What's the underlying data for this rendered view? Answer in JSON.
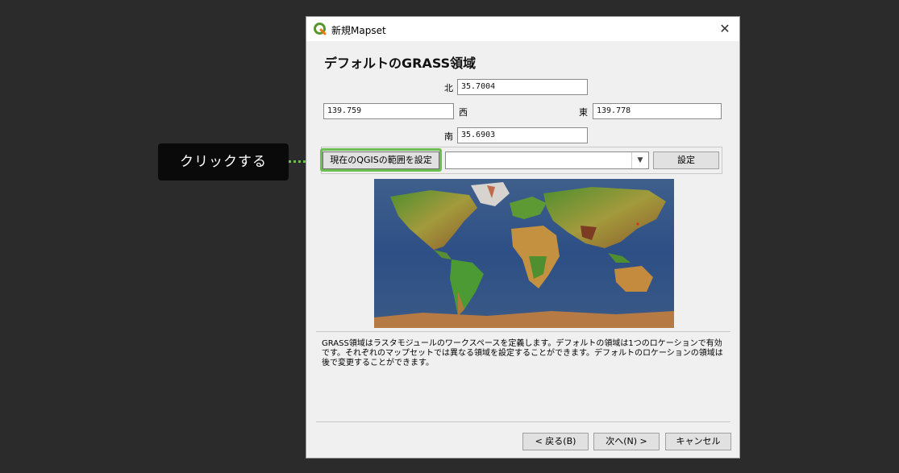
{
  "window": {
    "title": "新規Mapset",
    "close_glyph": "✕"
  },
  "page": {
    "heading": "デフォルトのGRASS領域"
  },
  "region": {
    "north_label": "北",
    "north_value": "35.7004",
    "west_value": "139.759",
    "west_label": "西",
    "east_label": "東",
    "east_value": "139.778",
    "south_label": "南",
    "south_value": "35.6903"
  },
  "extent": {
    "qgis_button_label": "現在のQGISの範囲を設定",
    "combo_value": "",
    "combo_arrow": "▼",
    "set_button_label": "設定"
  },
  "description": "GRASS領域はラスタモジュールのワークスペースを定義します。デフォルトの領域は1つのロケーションで有効です。それぞれのマップセットでは異なる領域を設定することができます。デフォルトのロケーションの領域は後で変更することができます。",
  "footer": {
    "back_label": "< 戻る(B)",
    "next_label": "次へ(N) >",
    "cancel_label": "キャンセル"
  },
  "annotation": {
    "callout_text": "クリックする",
    "highlight_color": "#6ac04f"
  },
  "icons": {
    "app": "qgis-logo-icon",
    "close": "close-icon",
    "combo": "chevron-down-icon"
  }
}
